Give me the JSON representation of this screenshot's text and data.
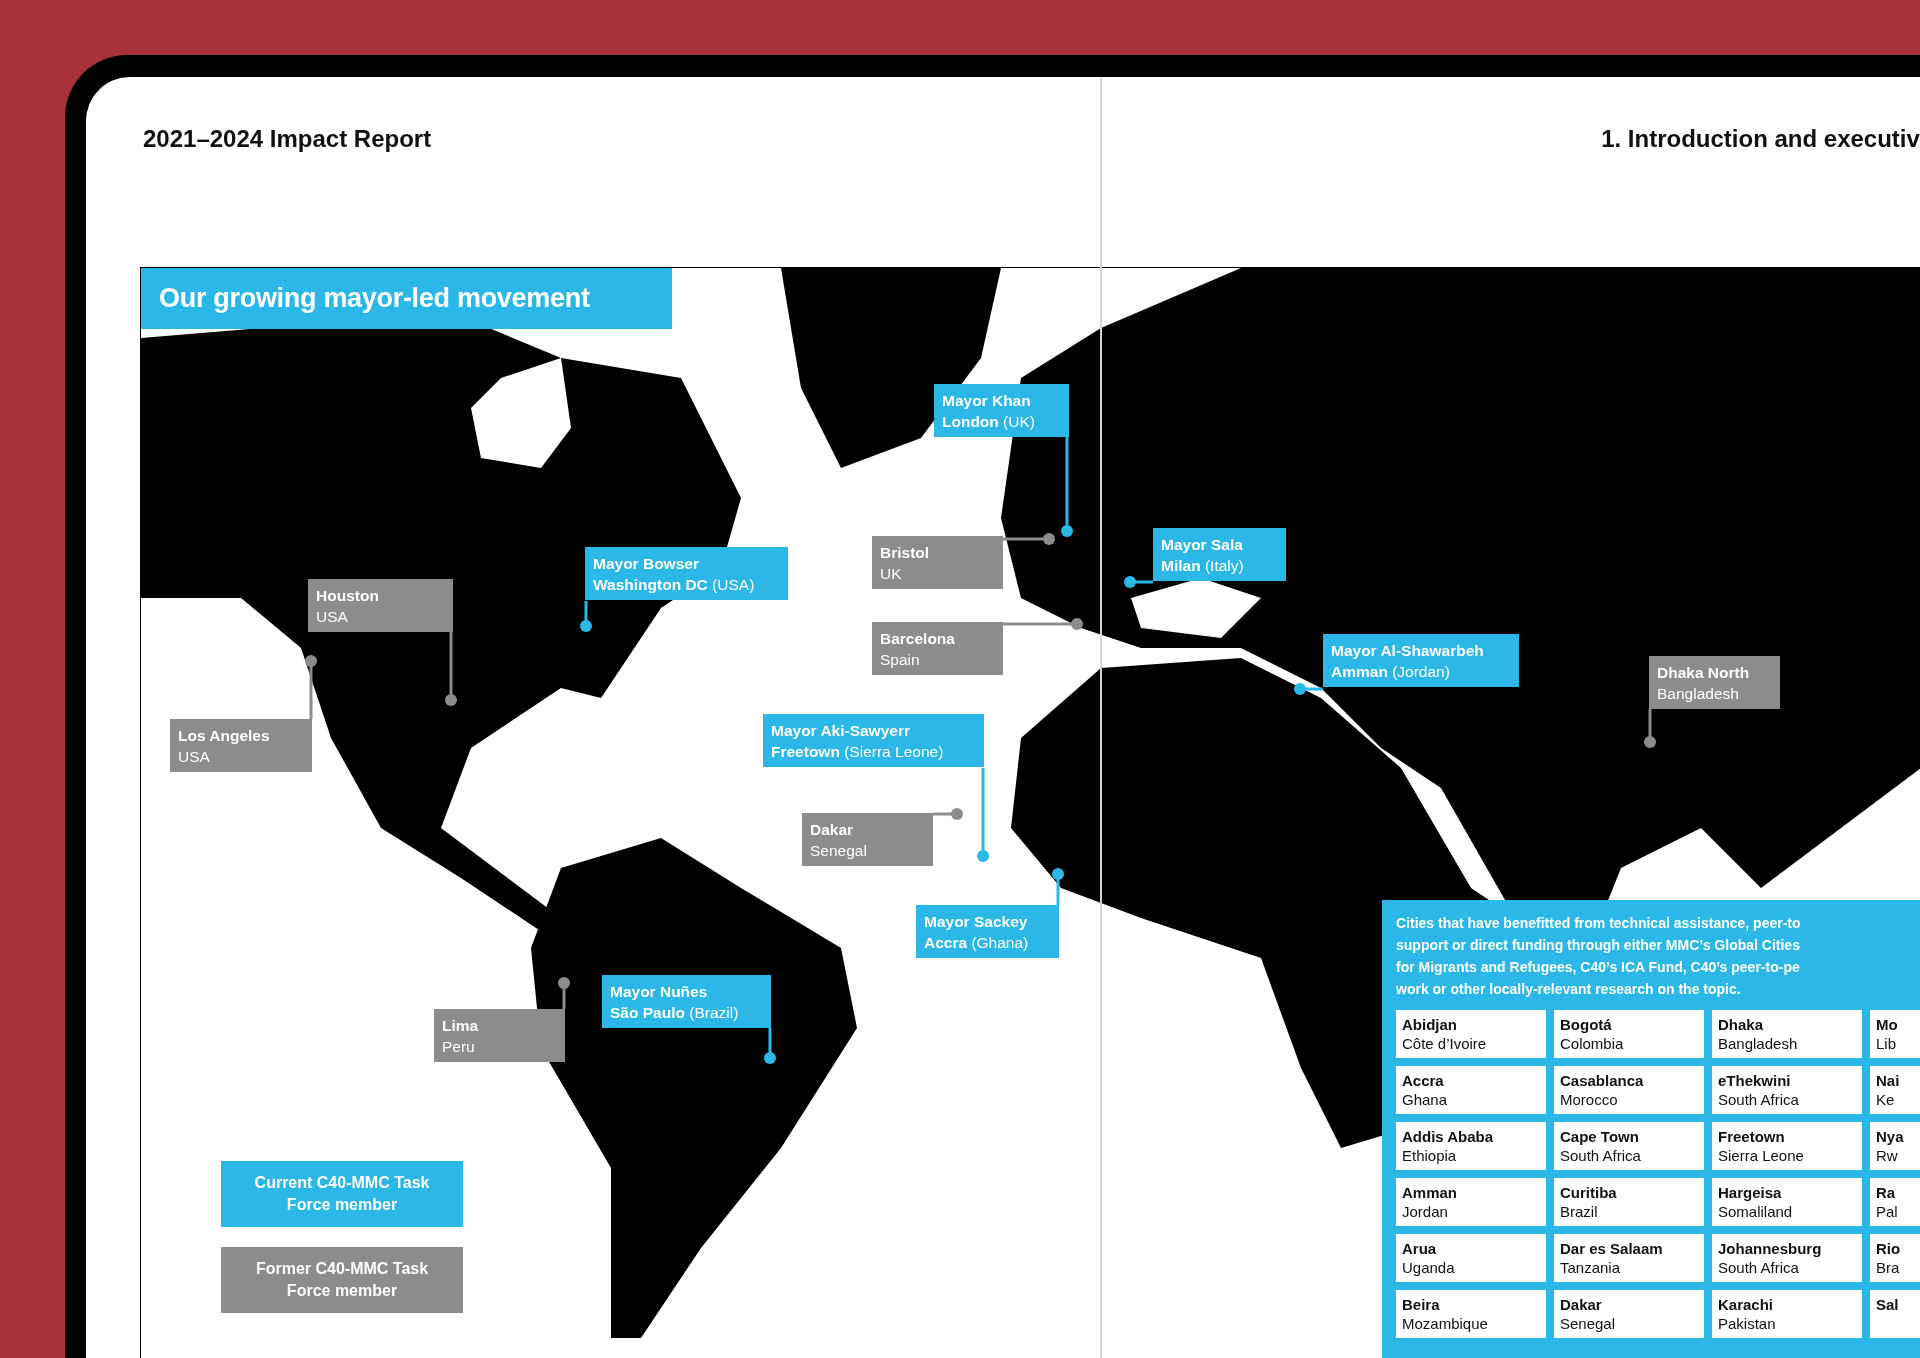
{
  "header": {
    "report_title": "2021–2024 Impact Report",
    "section_title": "1. Introduction and executiv"
  },
  "map": {
    "kind": "picture",
    "title": "Our growing mayor-led movement",
    "labels": [
      {
        "kind": "current",
        "title": "Mayor Khan",
        "subtitle": "**London** (UK)"
      },
      {
        "kind": "former",
        "title": "Houston",
        "subtitle": "USA"
      },
      {
        "kind": "current",
        "title": "Mayor Bowser",
        "subtitle": "**Washington DC** (USA)"
      },
      {
        "kind": "former",
        "title": "Bristol",
        "subtitle": "UK"
      },
      {
        "kind": "current",
        "title": "Mayor Sala",
        "subtitle": "**Milan** (Italy)"
      },
      {
        "kind": "former",
        "title": "Barcelona",
        "subtitle": "Spain"
      },
      {
        "kind": "current",
        "title": "Mayor Al-Shawarbeh",
        "subtitle": "**Amman** (Jordan)"
      },
      {
        "kind": "former",
        "title": "Dhaka North",
        "subtitle": "Bangladesh"
      },
      {
        "kind": "former",
        "title": "Los Angeles",
        "subtitle": "USA"
      },
      {
        "kind": "current",
        "title": "Mayor Aki-Sawyerr",
        "subtitle": "**Freetown** (Sierra Leone)"
      },
      {
        "kind": "former",
        "title": "Dakar",
        "subtitle": "Senegal"
      },
      {
        "kind": "current",
        "title": "Mayor Sackey",
        "subtitle": "**Accra** (Ghana)"
      },
      {
        "kind": "former",
        "title": "Lima",
        "subtitle": "Peru"
      },
      {
        "kind": "current",
        "title": "Mayor Nuñes",
        "subtitle": "**São Paulo** (Brazil)"
      }
    ]
  },
  "legend": [
    {
      "kind": "current",
      "label": "Current C40-MMC Task Force member"
    },
    {
      "kind": "former",
      "label": "Former C40-MMC Task Force member"
    }
  ],
  "cities_panel": {
    "description": [
      "Cities that have benefitted from technical assistance, peer-to",
      "support or direct funding through either MMC’s Global Cities",
      "for Migrants and Refugees, C40’s ICA Fund, C40’s peer-to-pe",
      "work or other locally-relevant research on the topic."
    ],
    "cities": [
      {
        "city": "Abidjan",
        "country": "Côte d’Ivoire"
      },
      {
        "city": "Bogotá",
        "country": "Colombia"
      },
      {
        "city": "Dhaka",
        "country": "Bangladesh"
      },
      {
        "city": "Mo",
        "country": "Lib"
      },
      {
        "city": "Accra",
        "country": "Ghana"
      },
      {
        "city": "Casablanca",
        "country": "Morocco"
      },
      {
        "city": "eThekwini",
        "country": "South Africa"
      },
      {
        "city": "Nai",
        "country": "Ke"
      },
      {
        "city": "Addis Ababa",
        "country": "Ethiopia"
      },
      {
        "city": "Cape Town",
        "country": "South Africa"
      },
      {
        "city": "Freetown",
        "country": "Sierra Leone"
      },
      {
        "city": "Nya",
        "country": "Rw"
      },
      {
        "city": "Amman",
        "country": "Jordan"
      },
      {
        "city": "Curitiba",
        "country": "Brazil"
      },
      {
        "city": "Hargeisa",
        "country": "Somaliland"
      },
      {
        "city": "Ra",
        "country": "Pal"
      },
      {
        "city": "Arua",
        "country": "Uganda"
      },
      {
        "city": "Dar es Salaam",
        "country": "Tanzania"
      },
      {
        "city": "Johannesburg",
        "country": "South Africa"
      },
      {
        "city": "Rio",
        "country": "Bra"
      },
      {
        "city": "Beira",
        "country": "Mozambique"
      },
      {
        "city": "Dakar",
        "country": "Senegal"
      },
      {
        "city": "Karachi",
        "country": "Pakistan"
      },
      {
        "city": "Sal"
      }
    ]
  }
}
